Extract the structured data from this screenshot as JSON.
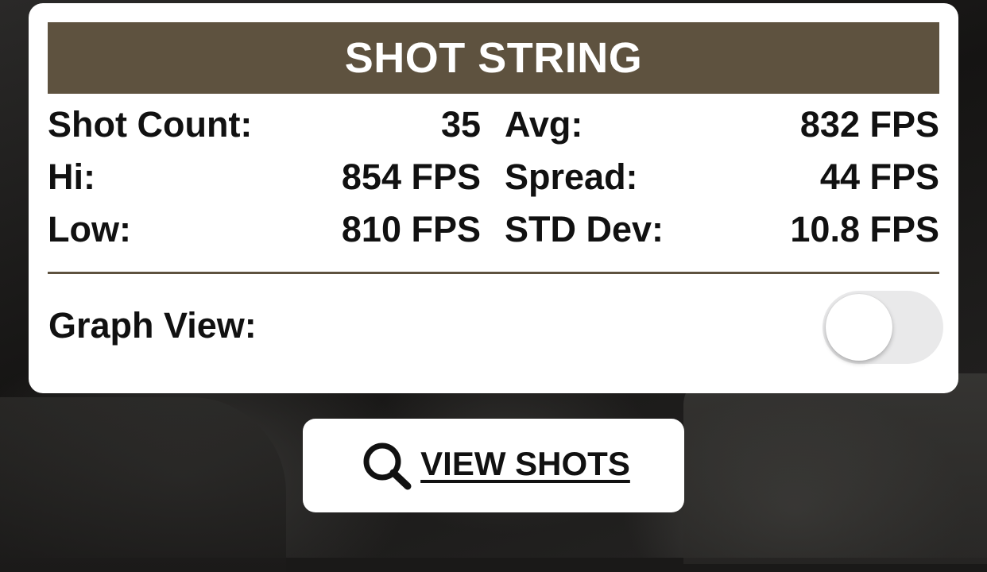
{
  "card": {
    "title": "SHOT STRING",
    "header_color": "#5e523f",
    "stats": [
      {
        "left_label": "Shot Count:",
        "left_value": "35",
        "right_label": "Avg:",
        "right_value": "832 FPS"
      },
      {
        "left_label": "Hi:",
        "left_value": "854 FPS",
        "right_label": "Spread:",
        "right_value": "44 FPS"
      },
      {
        "left_label": "Low:",
        "left_value": "810 FPS",
        "right_label": "STD Dev:",
        "right_value": "10.8 FPS"
      }
    ],
    "graph_view": {
      "label": "Graph View:",
      "enabled": false
    }
  },
  "view_shots_button": {
    "label": "VIEW SHOTS",
    "icon": "search-icon"
  }
}
